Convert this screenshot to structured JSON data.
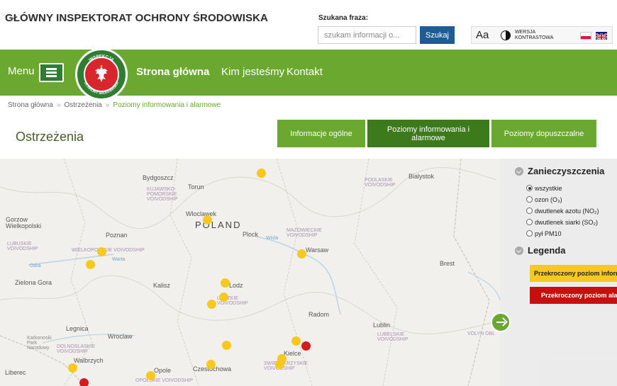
{
  "header": {
    "site_title": "GŁÓWNY INSPEKTORAT OCHRONY ŚRODOWISKA",
    "search_label": "Szukana fraza:",
    "search_placeholder": "szukam informacji o...",
    "search_button": "Szukaj",
    "font_size_label": "Aa",
    "contrast_label": "WERSJA KONTRASTOWA"
  },
  "nav": {
    "menu_label": "Menu",
    "logo_text": "INSPEKCJA OCHRONY ŚRODOWISKA",
    "links": [
      "Strona główna",
      "Kim jesteśmy",
      "Kontakt"
    ]
  },
  "breadcrumb": [
    "Strona główna",
    "Ostrzeżenia",
    "Poziomy informowania i alarmowe"
  ],
  "page": {
    "title": "Ostrzeżenia",
    "tabs": [
      "Informacje ogólne",
      "Poziomy informowania i alarmowe",
      "Poziomy dopuszczalne"
    ]
  },
  "map": {
    "country": "POLAND",
    "cities": [
      "Bydgoszcz",
      "Torun",
      "Bialystok",
      "Gorzow Wielkopolski",
      "Wloclawek",
      "Plock",
      "Poznan",
      "Warsaw",
      "Brest",
      "Zielona Gora",
      "Kalisz",
      "Lodz",
      "Radom",
      "Lublin",
      "Legnica",
      "Wroclaw",
      "Kielce",
      "Walbrzych",
      "Opole",
      "Czestochowa",
      "Liberec",
      "Warta",
      "Odra",
      "Wisla"
    ],
    "regions": [
      "KUJAWSKO-POMORSKIE VOIVODSHIP",
      "PODLASKIE VOIVODSHIP",
      "LUBUSKIE VOIVODSHIP",
      "WIELKOPOLSKIE VOIVODSHIP",
      "MAZOWIECKIE VOIVODSHIP",
      "LODZKIE VOIVODSHIP",
      "LUBELSKIE VOIVODSHIP",
      "DOLNOSLASKIE VOIVODSHIP",
      "SWIETOKRZYSKIE VOIVODSHIP",
      "OPOLSKIE VOIVODSHIP",
      "Karkonoski Park Narodowy",
      "VOLYN OBL"
    ]
  },
  "panel": {
    "pollutants_title": "Zanieczyszczenia",
    "pollutant_options": [
      "wszystkie",
      "ozon (O₃)",
      "dwutlenek azotu (NO₂)",
      "dwutlenek siarki (SO₂)",
      "pył PM10"
    ],
    "selected_option": "wszystkie",
    "legend_title": "Legenda",
    "legend_items": [
      "Przekroczony poziom informowania",
      "Przekroczony poziom alarmowy"
    ]
  },
  "colors": {
    "brand_green": "#6aa82f",
    "active_tab": "#3d7a1b",
    "search_blue": "#1f5c96",
    "warning_yellow": "#f7c81e",
    "alarm_red": "#d41c1c"
  }
}
